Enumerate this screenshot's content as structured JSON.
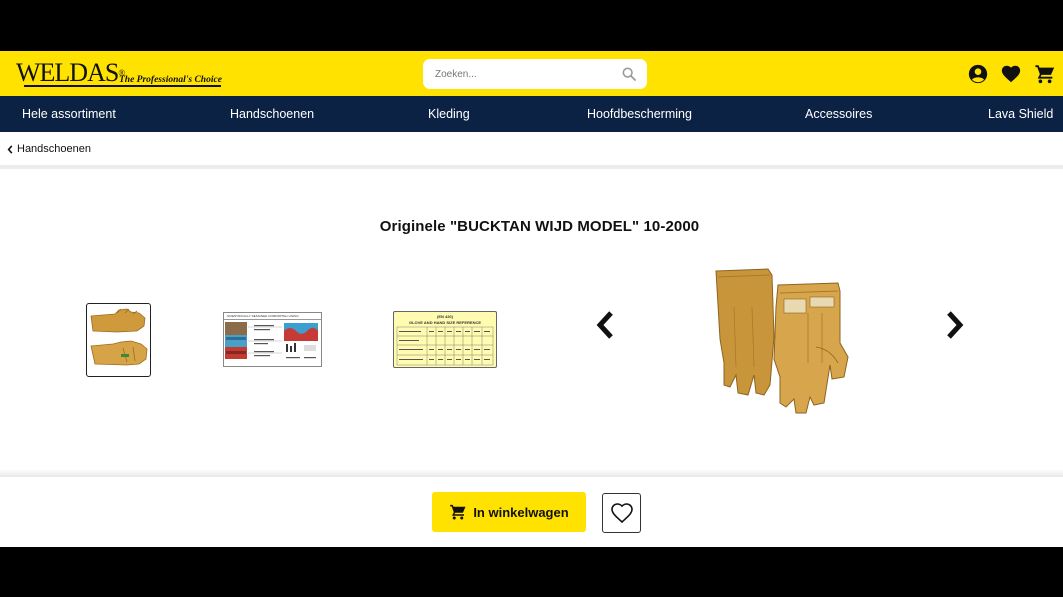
{
  "header": {
    "logo_text": "WELDAS",
    "logo_reg": "®",
    "logo_tagline": "The Professional's Choice",
    "search_placeholder": "Zoeken...",
    "icons": [
      "account-icon",
      "heart-icon",
      "cart-icon"
    ],
    "accent_color": "#ffe200"
  },
  "nav": {
    "items": [
      {
        "label": "Hele assortiment"
      },
      {
        "label": "Handschoenen"
      },
      {
        "label": "Kleding"
      },
      {
        "label": "Hoofdbescherming"
      },
      {
        "label": "Accessoires"
      },
      {
        "label": "Lava Shield"
      }
    ],
    "background_color": "#0c2244"
  },
  "breadcrumb": {
    "back_label": "Handschoenen"
  },
  "product": {
    "title": "Originele \"BUCKTAN WIJD MODEL\" 10-2000",
    "thumbnails": [
      {
        "name": "glove-photo"
      },
      {
        "name": "lining-diagram",
        "caption": "SCIENTIFICALLY DESIGNED COMFORTflex LINING"
      },
      {
        "name": "size-chart",
        "caption_top": "(EN 420)",
        "caption": "GLOVE AND HAND SIZE REFERENCE"
      }
    ]
  },
  "actions": {
    "add_to_cart_label": "In winkelwagen"
  }
}
